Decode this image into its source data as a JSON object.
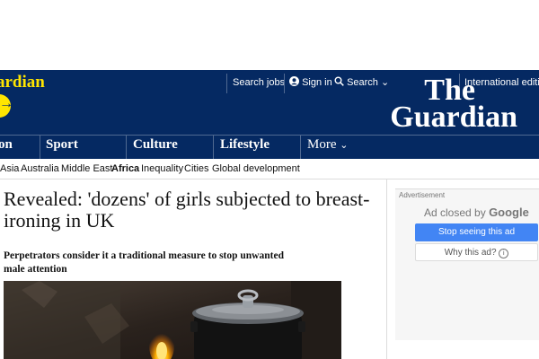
{
  "header": {
    "support_text": "ardian",
    "links": {
      "search_jobs": "Search jobs",
      "sign_in": "Sign in",
      "search": "Search",
      "edition": "International editi"
    },
    "logo_line1": "The",
    "logo_line2": "Guardian"
  },
  "nav": {
    "items": [
      {
        "label": "on"
      },
      {
        "label": "Sport"
      },
      {
        "label": "Culture"
      },
      {
        "label": "Lifestyle"
      },
      {
        "label": "More"
      }
    ]
  },
  "subnav": {
    "items": [
      {
        "label": "Asia"
      },
      {
        "label": "Australia"
      },
      {
        "label": "Middle East"
      },
      {
        "label": "Africa"
      },
      {
        "label": "Inequality"
      },
      {
        "label": "Cities"
      },
      {
        "label": "Global development"
      }
    ]
  },
  "article": {
    "headline": "Revealed: 'dozens' of girls subjected to breast-ironing in UK",
    "standfirst": "Perpetrators consider it a traditional measure to stop unwanted male attention"
  },
  "ad": {
    "label": "Advertisement",
    "closed_prefix": "Ad closed by",
    "closed_brand": "Google",
    "stop_button": "Stop seeing this ad",
    "why_button": "Why this ad?"
  },
  "colors": {
    "brand_blue": "#052962",
    "accent_yellow": "#ffe500",
    "google_blue": "#4285f4"
  }
}
